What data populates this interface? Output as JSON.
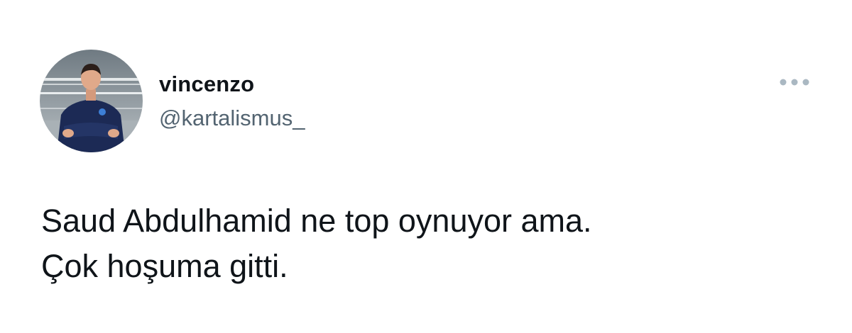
{
  "tweet": {
    "author": {
      "display_name": "vincenzo",
      "handle": "@kartalismus_",
      "avatar_icon": "profile-photo-coach-arms-crossed"
    },
    "more_icon": "more-horizontal-icon",
    "text_lines": [
      "Saud Abdulhamid ne top oynuyor ama.",
      "Çok hoşuma gitti."
    ]
  },
  "colors": {
    "text_primary": "#0f1419",
    "text_secondary": "#536471",
    "icon_muted": "#aab8c2",
    "background": "#ffffff"
  }
}
